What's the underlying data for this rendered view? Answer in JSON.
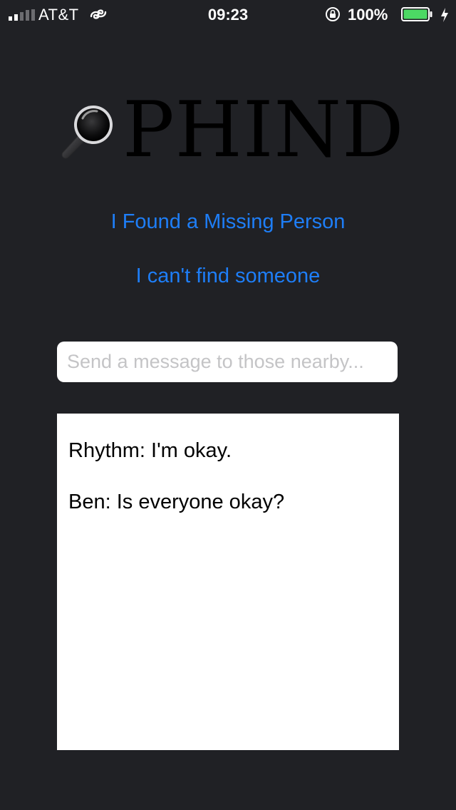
{
  "status_bar": {
    "carrier": "AT&T",
    "time": "09:23",
    "battery_percent": "100%",
    "battery_level": 1.0,
    "signal_bars_filled": 2,
    "signal_bars_total": 5,
    "icons": [
      "signal-icon",
      "link-icon",
      "orientation-lock-icon",
      "battery-icon",
      "charging-bolt-icon"
    ]
  },
  "logo": {
    "text": "PHIND",
    "icon": "magnifier-icon"
  },
  "links": {
    "found": "I Found a Missing Person",
    "cant_find": "I can't find someone"
  },
  "message_input": {
    "value": "",
    "placeholder": "Send a message to those nearby..."
  },
  "messages": [
    {
      "text": "Rhythm: I'm okay."
    },
    {
      "text": "Ben: Is everyone okay?"
    }
  ],
  "colors": {
    "background": "#202125",
    "link": "#1e7ef7",
    "battery_fill": "#4cd964",
    "panel": "#ffffff"
  }
}
